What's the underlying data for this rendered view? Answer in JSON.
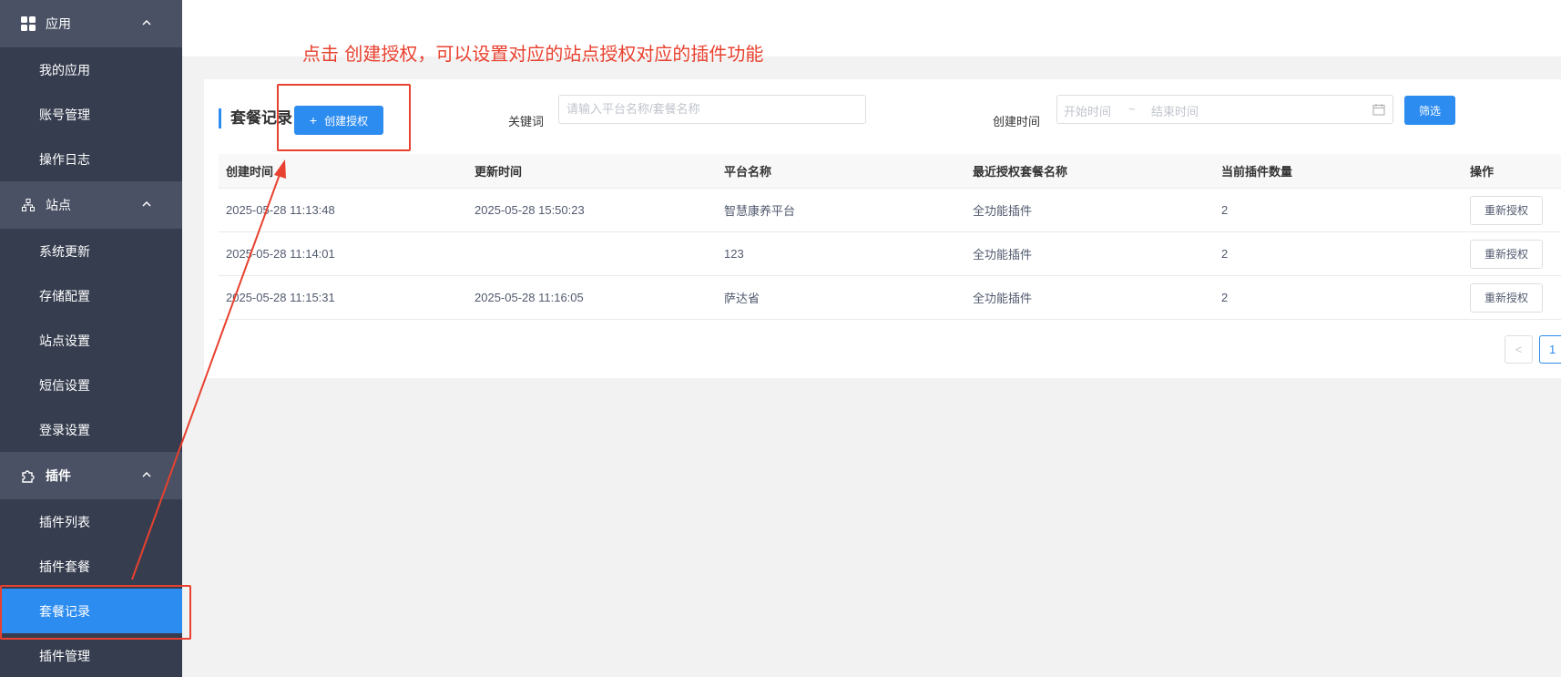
{
  "sidebar": {
    "groups": [
      {
        "label": "应用",
        "icon": "grid-icon",
        "items": [
          "我的应用",
          "账号管理",
          "操作日志"
        ]
      },
      {
        "label": "站点",
        "icon": "sitemap-icon",
        "items": [
          "系统更新",
          "存储配置",
          "站点设置",
          "短信设置",
          "登录设置"
        ]
      },
      {
        "label": "插件",
        "icon": "puzzle-icon",
        "items": [
          "插件列表",
          "插件套餐",
          "套餐记录",
          "插件管理"
        ],
        "active": "套餐记录"
      }
    ]
  },
  "annotation": "点击  创建授权，可以设置对应的站点授权对应的插件功能",
  "card": {
    "title": "套餐记录",
    "create_button": "创建授权",
    "keyword_label": "关键词",
    "keyword_placeholder": "请输入平台名称/套餐名称",
    "created_time_label": "创建时间",
    "range_start": "开始时间",
    "range_sep": "~",
    "range_end": "结束时间",
    "filter_button": "筛选"
  },
  "table": {
    "headers": [
      "创建时间",
      "更新时间",
      "平台名称",
      "最近授权套餐名称",
      "当前插件数量",
      "操作"
    ],
    "rows": [
      {
        "created": "2025-05-28 11:13:48",
        "updated": "2025-05-28 15:50:23",
        "platform": "智慧康养平台",
        "package": "全功能插件",
        "count": "2",
        "action": "重新授权"
      },
      {
        "created": "2025-05-28 11:14:01",
        "updated": "",
        "platform": "123",
        "package": "全功能插件",
        "count": "2",
        "action": "重新授权"
      },
      {
        "created": "2025-05-28 11:15:31",
        "updated": "2025-05-28 11:16:05",
        "platform": "萨达省",
        "package": "全功能插件",
        "count": "2",
        "action": "重新授权"
      }
    ]
  },
  "pagination": {
    "prev": "<",
    "current": "1"
  },
  "colors": {
    "primary": "#2d8cf0",
    "sidebar": "#363d4f",
    "annotation": "#e8412f"
  }
}
